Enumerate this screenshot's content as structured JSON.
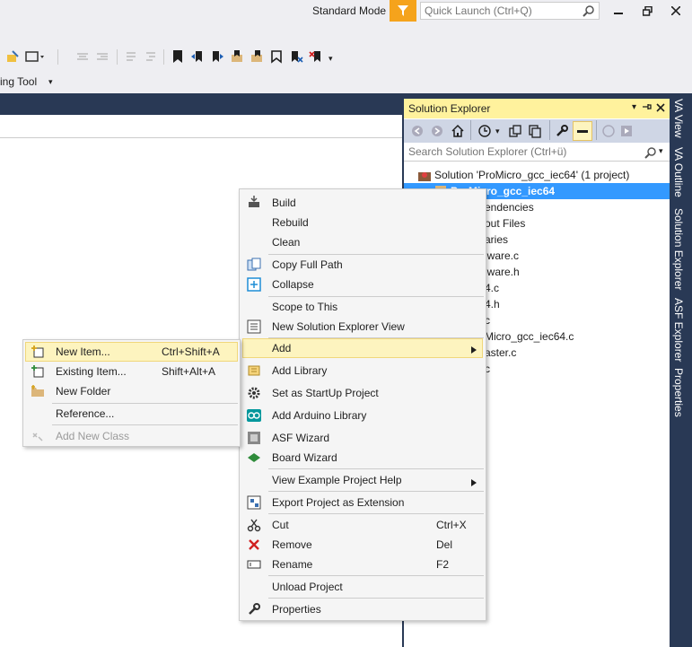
{
  "titlebar": {
    "mode_label": "Standard Mode",
    "quick_launch_placeholder": "Quick Launch (Ctrl+Q)"
  },
  "toolbar": {
    "secondary_label": "ing Tool"
  },
  "solution_explorer": {
    "title": "Solution Explorer",
    "search_placeholder": "Search Solution Explorer (Ctrl+ü)",
    "tree": [
      "Solution 'ProMicro_gcc_iec64' (1 project)",
      "ProMicro_gcc_iec64",
      "endencies",
      "out Files",
      "aries",
      "lware.c",
      "lware.h",
      "4.c",
      "4.h",
      "c",
      "Micro_gcc_iec64.c",
      "aster.c",
      "c"
    ]
  },
  "side_tabs": [
    "VA View",
    "VA Outline",
    "Solution Explorer",
    "ASF Explorer",
    "Properties"
  ],
  "context_menu": {
    "items": [
      {
        "label": "Build",
        "shortcut": "",
        "icon": "build-icon"
      },
      {
        "label": "Rebuild",
        "shortcut": "",
        "icon": ""
      },
      {
        "label": "Clean",
        "shortcut": "",
        "icon": ""
      },
      {
        "label": "Copy Full Path",
        "shortcut": "",
        "icon": "copy-icon"
      },
      {
        "label": "Collapse",
        "shortcut": "",
        "icon": "collapse-icon"
      },
      {
        "label": "Scope to This",
        "shortcut": "",
        "icon": ""
      },
      {
        "label": "New Solution Explorer View",
        "shortcut": "",
        "icon": "new-view-icon"
      },
      {
        "label": "Add",
        "shortcut": "",
        "icon": ""
      },
      {
        "label": "Add Library",
        "shortcut": "",
        "icon": "library-icon"
      },
      {
        "label": "Set as StartUp Project",
        "shortcut": "",
        "icon": "gear-icon"
      },
      {
        "label": "Add Arduino Library",
        "shortcut": "",
        "icon": "arduino-icon"
      },
      {
        "label": "ASF Wizard",
        "shortcut": "",
        "icon": "asf-icon"
      },
      {
        "label": "Board Wizard",
        "shortcut": "",
        "icon": "board-icon"
      },
      {
        "label": "View Example Project Help",
        "shortcut": "",
        "icon": ""
      },
      {
        "label": "Export Project as Extension",
        "shortcut": "",
        "icon": "export-icon"
      },
      {
        "label": "Cut",
        "shortcut": "Ctrl+X",
        "icon": "scissors-icon"
      },
      {
        "label": "Remove",
        "shortcut": "Del",
        "icon": "remove-icon"
      },
      {
        "label": "Rename",
        "shortcut": "F2",
        "icon": "rename-icon"
      },
      {
        "label": "Unload Project",
        "shortcut": "",
        "icon": ""
      },
      {
        "label": "Properties",
        "shortcut": "",
        "icon": "wrench-icon"
      }
    ]
  },
  "submenu": {
    "items": [
      {
        "label": "New Item...",
        "shortcut": "Ctrl+Shift+A"
      },
      {
        "label": "Existing Item...",
        "shortcut": "Shift+Alt+A"
      },
      {
        "label": "New Folder",
        "shortcut": ""
      },
      {
        "label": "Reference...",
        "shortcut": ""
      },
      {
        "label": "Add New Class",
        "shortcut": ""
      }
    ]
  },
  "colors": {
    "accent_dark": "#293955",
    "highlight": "#fdf4bf",
    "selection": "#3399ff",
    "filter_orange": "#f5a31c"
  }
}
